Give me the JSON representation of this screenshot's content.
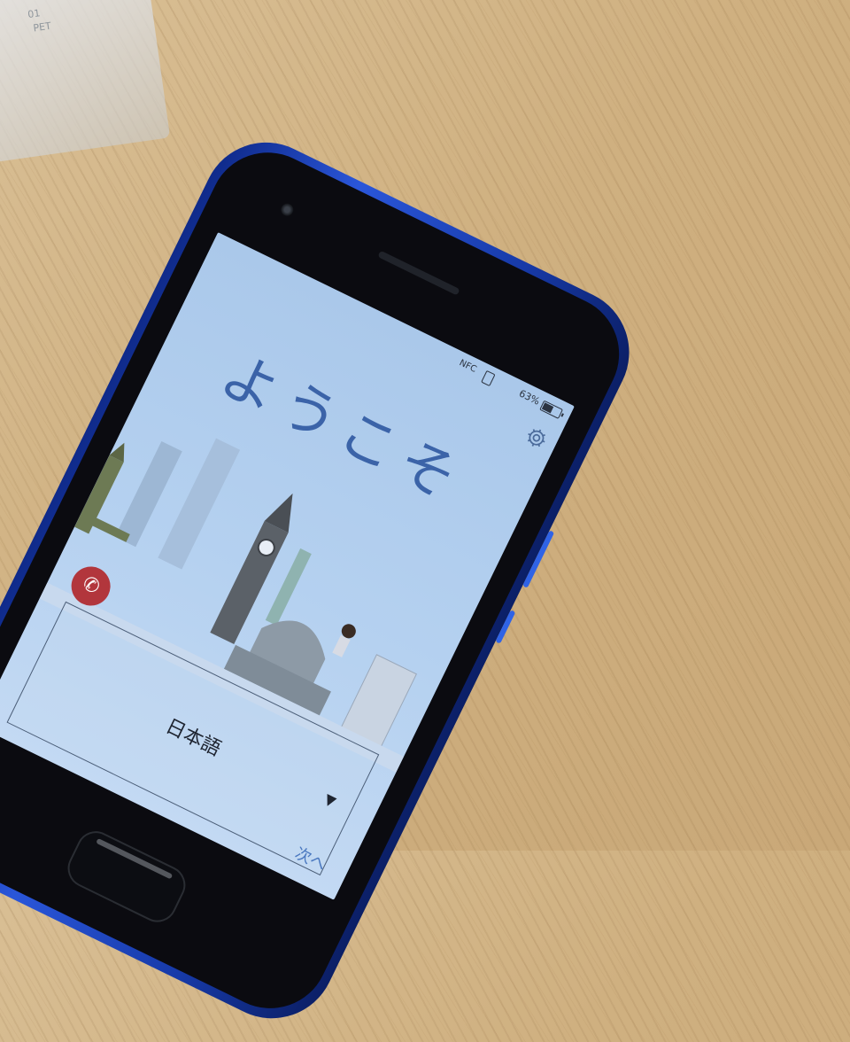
{
  "background": {
    "wood_color": "#cfb080",
    "packaging_labels": [
      "♲",
      "01",
      "PET"
    ]
  },
  "phone": {
    "chassis_color": "#1f47c4",
    "status_bar": {
      "nfc_label": "NFC",
      "battery_percent_label": "63%",
      "battery_level": 0.63
    },
    "icons": {
      "settings": "gear-icon",
      "call": "phone-icon",
      "dropdown": "triangle-down-icon"
    },
    "welcome_title": "ようこそ",
    "language_select": {
      "selected": "日本語",
      "arrow": "▼"
    },
    "call_icon_glyph": "✆",
    "next_label": "次へ",
    "colors": {
      "screen_bg": "#b5d1f0",
      "title": "#3b63a8",
      "call_button": "#b2363c",
      "next_text": "#4a78c0"
    }
  }
}
